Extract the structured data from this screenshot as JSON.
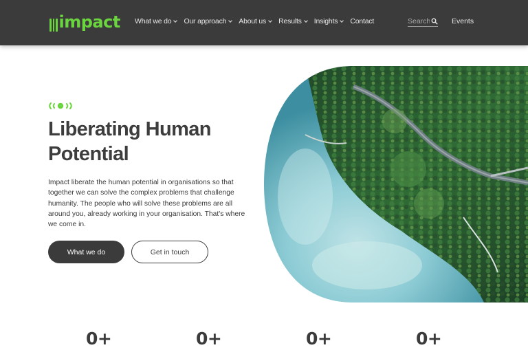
{
  "header": {
    "logo_text": "impact",
    "nav": [
      {
        "label": "What we do",
        "has_dropdown": true
      },
      {
        "label": "Our approach",
        "has_dropdown": true
      },
      {
        "label": "About us",
        "has_dropdown": true
      },
      {
        "label": "Results",
        "has_dropdown": true
      },
      {
        "label": "Insights",
        "has_dropdown": true
      },
      {
        "label": "Contact",
        "has_dropdown": false
      }
    ],
    "search_placeholder": "Search",
    "events_label": "Events"
  },
  "hero": {
    "title": "Liberating Human Potential",
    "body": "Impact liberate the human potential in organisations so that together we can solve the complex problems that challenge humanity. The people who will solve these problems are all around you, already working in your organisation. That's where we come in.",
    "primary_button": "What we do",
    "secondary_button": "Get in touch",
    "image_icon": "aerial-forest-lake-image"
  },
  "stats": [
    "0+",
    "0+",
    "0+",
    "0+"
  ],
  "colors": {
    "header_bg": "#3b3b3b",
    "brand_green": "#6bd53f",
    "text_dark": "#3d3d3d",
    "button_dark": "#3b3b3b"
  }
}
